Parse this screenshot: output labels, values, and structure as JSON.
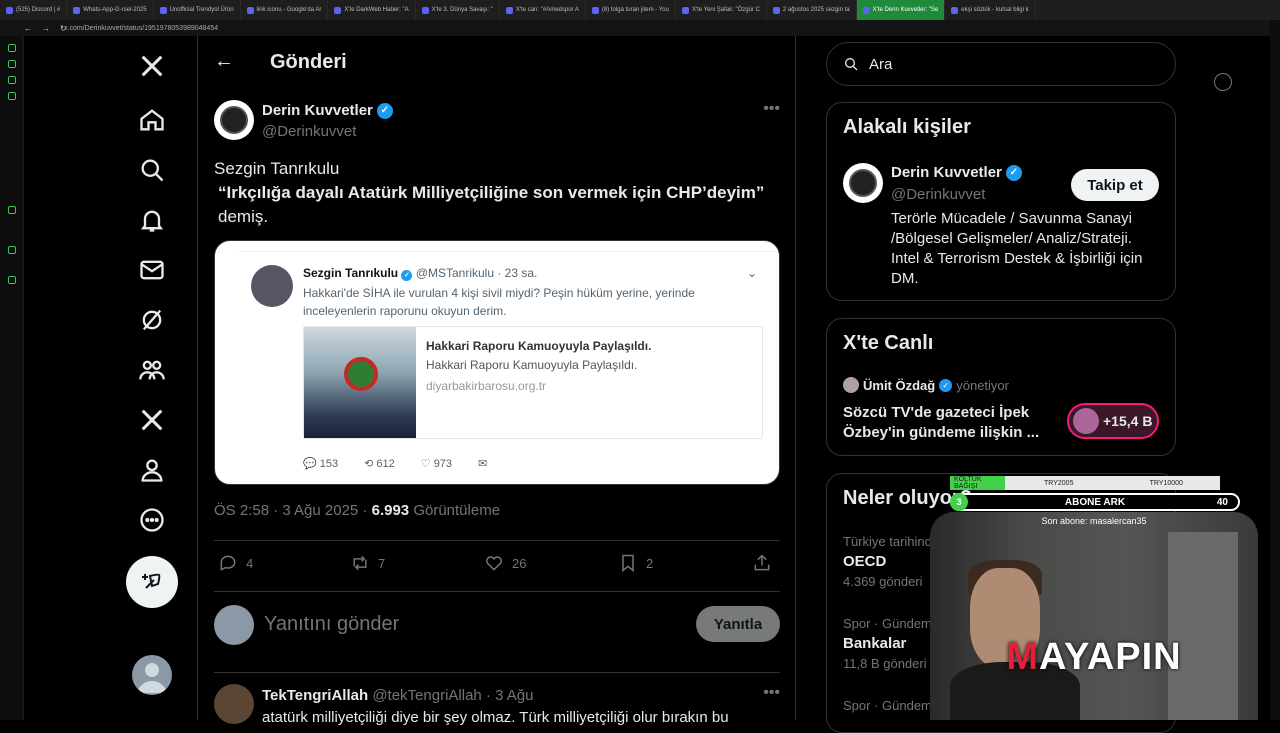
{
  "browser": {
    "tabs": [
      {
        "label": "(525) Discord | #"
      },
      {
        "label": "Whats-App-G-rsel-2025"
      },
      {
        "label": "Unofficial Trendyol Ürün"
      },
      {
        "label": "link iconu - Google'da Ar"
      },
      {
        "label": "X'te DarkWeb Haber: \"A"
      },
      {
        "label": "X'te 3. Dünya Savaşı: \""
      },
      {
        "label": "X'te can: \"#Amedspor A"
      },
      {
        "label": "(8) tolga turan jitem - You"
      },
      {
        "label": "X'te Yeni Şafak: \"Özgür C"
      },
      {
        "label": "2 ağustos 2025 sezgin ta"
      },
      {
        "label": "X'te Derin Kuvvetler: \"Se",
        "active": true
      },
      {
        "label": "ekşi sözlük - kutsal bilgi k"
      }
    ],
    "url": "x.com/Derinkuvvet/status/1951978053989048454"
  },
  "header": {
    "title": "Gönderi"
  },
  "post": {
    "author": "Derin Kuvvetler",
    "handle": "@Derinkuvvet",
    "text_line1": "Sezgin Tanrıkulu",
    "text_quote": "“Irkçılığa dayalı Atatürk Milliyetçiliğine son vermek için CHP’deyim”",
    "text_line3": "demiş.",
    "embed": {
      "name": "Sezgin Tanrıkulu",
      "handle": "@MSTanrikulu · 23 sa.",
      "text": "Hakkari'de SİHA ile vurulan 4 kişi sivil miydi? Peşin hüküm yerine, yerinde inceleyenlerin raporunu okuyun derim.",
      "link_title": "Hakkari Raporu Kamuoyuyla Paylaşıldı.",
      "link_desc": "Hakkari Raporu Kamuoyuyla Paylaşıldı.",
      "link_domain": "diyarbakirbarosu.org.tr",
      "replies": "153",
      "retweets": "612",
      "likes": "973"
    },
    "time": "ÖS 2:58 · 3 Ağu 2025 ·",
    "views": "6.993",
    "views_label": "Görüntüleme",
    "stats": {
      "replies": "4",
      "reposts": "7",
      "likes": "26",
      "bookmarks": "2"
    }
  },
  "reply": {
    "placeholder": "Yanıtını gönder",
    "button": "Yanıtla"
  },
  "comment": {
    "name": "TekTengriAllah",
    "handle": "@tekTengriAllah · 3 Ağu",
    "text": "atatürk milliyetçiliği diye bir şey olmaz. Türk milliyetçiliği olur bırakın bu"
  },
  "right": {
    "search_placeholder": "Ara",
    "related": {
      "title": "Alakalı kişiler",
      "name": "Derin Kuvvetler",
      "handle": "@Derinkuvvet",
      "follow": "Takip et",
      "bio": "Terörle Mücadele / Savunma Sanayi /Bölgesel Gelişmeler/ Analiz/Strateji. Intel & Terrorism Destek & İşbirliği için DM."
    },
    "live": {
      "title": "X'te Canlı",
      "host": "Ümit Özdağ",
      "role": "yönetiyor",
      "topic": "Sözcü TV'de gazeteci İpek Özbey'in gündeme ilişkin ...",
      "count": "+15,4 B"
    },
    "trends": {
      "title": "Neler oluyor?",
      "items": [
        {
          "context": "Türkiye tarihinde",
          "name": "OECD",
          "count": "4.369 gönderi"
        },
        {
          "context": "Spor · Gündemde",
          "name": "Bankalar",
          "count": "11,8 B gönderi"
        },
        {
          "context": "Spor · Gündemdekiler"
        }
      ]
    }
  },
  "overlay": {
    "bar_left": "KOLTUK BAĞIŞI",
    "bar_mid": "TRY2005",
    "bar_right": "TRY10000",
    "sub_num": "3",
    "sub_label": "ABONE ARK",
    "sub_count": "40",
    "last_sub": "Son abone: masalercan35",
    "logo_a": "M",
    "logo_b": "AYAPIN"
  }
}
